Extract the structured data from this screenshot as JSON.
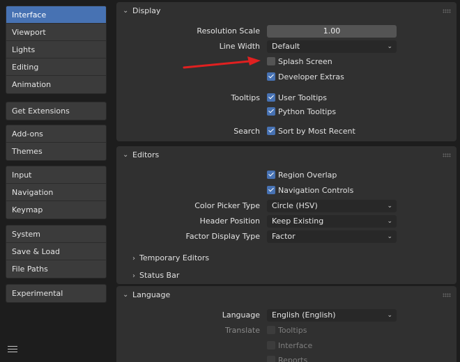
{
  "sidebar": {
    "groups": [
      [
        "Interface",
        "Viewport",
        "Lights",
        "Editing",
        "Animation"
      ],
      [
        "Get Extensions"
      ],
      [
        "Add-ons",
        "Themes"
      ],
      [
        "Input",
        "Navigation",
        "Keymap"
      ],
      [
        "System",
        "Save & Load",
        "File Paths"
      ],
      [
        "Experimental"
      ]
    ],
    "active": "Interface"
  },
  "display": {
    "title": "Display",
    "resolution_scale_label": "Resolution Scale",
    "resolution_scale_value": "1.00",
    "line_width_label": "Line Width",
    "line_width_value": "Default",
    "splash_screen": "Splash Screen",
    "developer_extras": "Developer Extras",
    "tooltips_label": "Tooltips",
    "user_tooltips": "User Tooltips",
    "python_tooltips": "Python Tooltips",
    "search_label": "Search",
    "sort_recent": "Sort by Most Recent"
  },
  "editors": {
    "title": "Editors",
    "region_overlap": "Region Overlap",
    "navigation_controls": "Navigation Controls",
    "color_picker_label": "Color Picker Type",
    "color_picker_value": "Circle (HSV)",
    "header_position_label": "Header Position",
    "header_position_value": "Keep Existing",
    "factor_display_label": "Factor Display Type",
    "factor_display_value": "Factor",
    "temporary_editors": "Temporary Editors",
    "status_bar": "Status Bar"
  },
  "language": {
    "title": "Language",
    "language_label": "Language",
    "language_value": "English (English)",
    "translate_label": "Translate",
    "tooltips": "Tooltips",
    "interface": "Interface",
    "reports": "Reports"
  },
  "colors": {
    "accent": "#4772b3",
    "annotation_arrow": "#e02020"
  }
}
